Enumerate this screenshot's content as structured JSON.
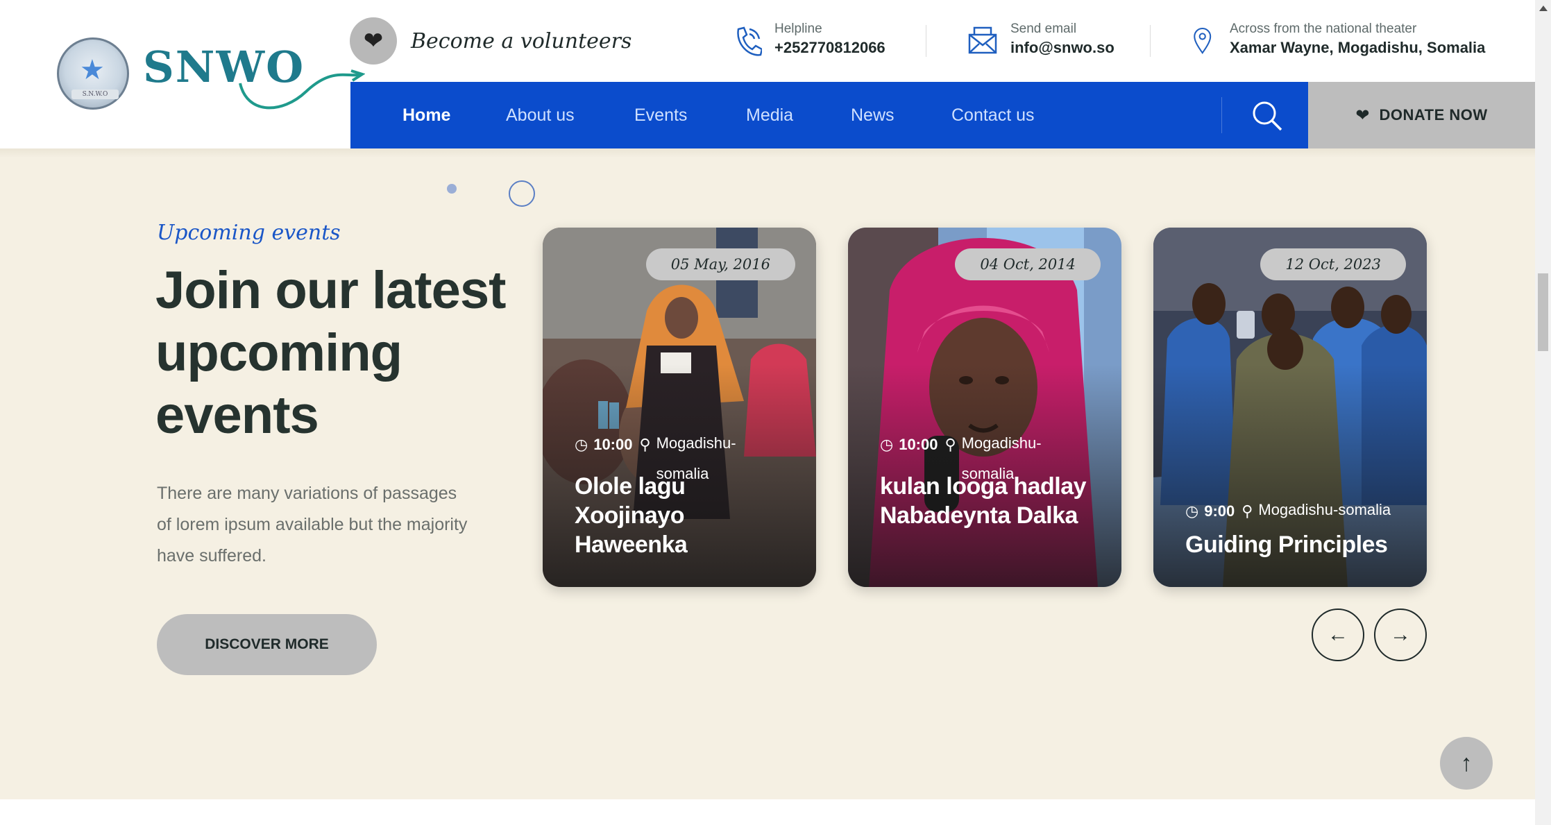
{
  "header": {
    "logo_text": "SNWO",
    "logo_band": "S.N.W.O",
    "volunteer_label": "Become a volunteers",
    "contacts": [
      {
        "icon": "phone-icon",
        "label": "Helpline",
        "value": "+252770812066"
      },
      {
        "icon": "mail-icon",
        "label": "Send email",
        "value": "info@snwo.so"
      },
      {
        "icon": "location-pin-icon",
        "label": "Across from the national theater",
        "value": "Xamar Wayne, Mogadishu, Somalia"
      }
    ]
  },
  "nav": {
    "items": [
      {
        "label": "Home",
        "active": true
      },
      {
        "label": "About us",
        "active": false
      },
      {
        "label": "Events",
        "active": false
      },
      {
        "label": "Media",
        "active": false
      },
      {
        "label": "News",
        "active": false
      },
      {
        "label": "Contact us",
        "active": false
      }
    ],
    "donate_label": "DONATE NOW"
  },
  "events": {
    "eyebrow": "Upcoming events",
    "heading": "Join our latest upcoming events",
    "description": "There are many variations of passages of lorem ipsum available but the majority have suffered.",
    "discover_label": "DISCOVER MORE",
    "cards": [
      {
        "date": "05 May, 2016",
        "time": "10:00",
        "location": "Mogadishu-somalia",
        "title": "Olole lagu Xoojinayo Haweenka"
      },
      {
        "date": "04 Oct, 2014",
        "time": "10:00",
        "location": "Mogadishu-somalia",
        "title": "kulan looga hadlay Nabadeynta Dalka"
      },
      {
        "date": "12 Oct, 2023",
        "time": "9:00",
        "location": "Mogadishu-somalia",
        "title": "Guiding Principles"
      }
    ],
    "prev_arrow": "←",
    "next_arrow": "→"
  },
  "back_to_top": "↑",
  "colors": {
    "brand_blue": "#0b4ccc",
    "section_bg": "#f5f0e3",
    "dark_text": "#26332f",
    "button_grey": "#bdbdbd"
  }
}
